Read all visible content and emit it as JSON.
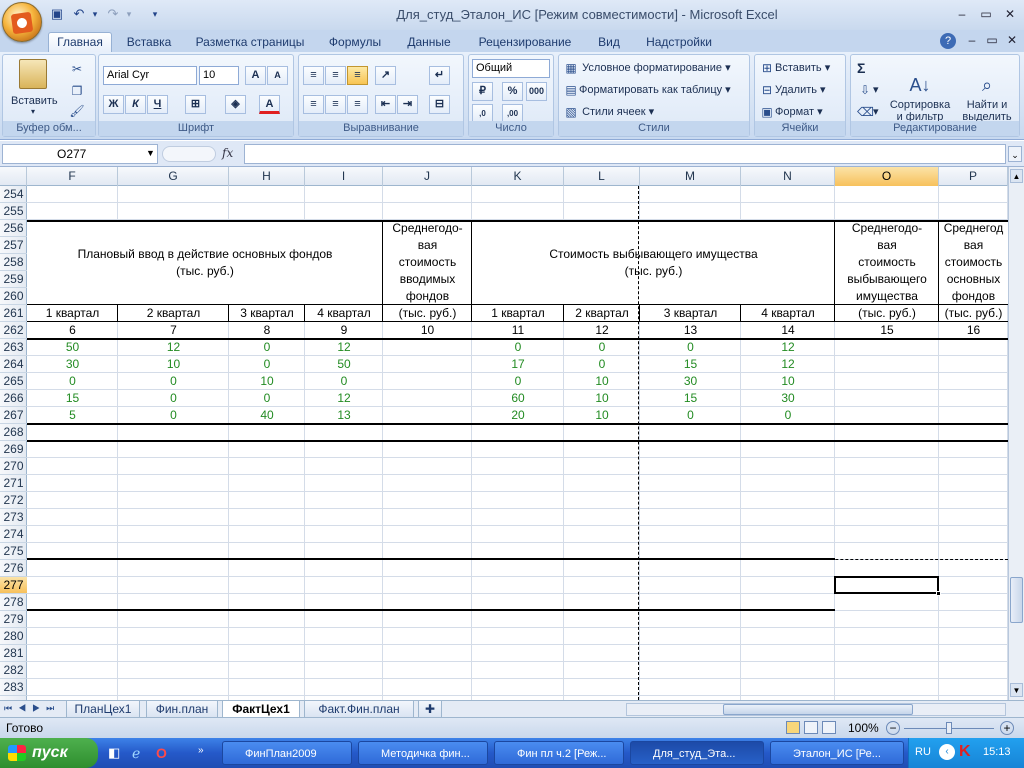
{
  "window": {
    "title": "Для_студ_Эталон_ИС  [Режим совместимости] - Microsoft Excel"
  },
  "tabs": [
    "Главная",
    "Вставка",
    "Разметка страницы",
    "Формулы",
    "Данные",
    "Рецензирование",
    "Вид",
    "Надстройки"
  ],
  "ribbon": {
    "clipboard": {
      "paste": "Вставить",
      "label": "Буфер обм..."
    },
    "font": {
      "name": "Arial Cyr",
      "size": "10",
      "bold": "Ж",
      "italic": "К",
      "underline": "Ч",
      "label": "Шрифт"
    },
    "alignment": {
      "label": "Выравнивание"
    },
    "number": {
      "format": "Общий",
      "percent": "%",
      "thousands": "000",
      "label": "Число"
    },
    "styles": {
      "conditional": "Условное форматирование",
      "table": "Форматировать как таблицу",
      "cell": "Стили ячеек",
      "label": "Стили"
    },
    "cells": {
      "insert": "Вставить",
      "delete": "Удалить",
      "format": "Формат",
      "label": "Ячейки"
    },
    "editing": {
      "sum": "Σ",
      "sort": "Сортировка\nи фильтр",
      "find": "Найти и\nвыделить",
      "label": "Редактирование"
    }
  },
  "formula_bar": {
    "name_box": "O277",
    "fx": "fx",
    "value": ""
  },
  "columns": [
    "F",
    "G",
    "H",
    "I",
    "J",
    "K",
    "L",
    "M",
    "N",
    "O",
    "P"
  ],
  "rows": [
    "254",
    "255",
    "256",
    "257",
    "258",
    "259",
    "260",
    "261",
    "262",
    "263",
    "264",
    "265",
    "266",
    "267",
    "268",
    "269",
    "270",
    "271",
    "272",
    "273",
    "274",
    "275",
    "276",
    "277",
    "278",
    "279",
    "280",
    "281",
    "282",
    "283"
  ],
  "headers": {
    "planned": "Плановый ввод в действие основных фондов",
    "planned_unit": "(тыс. руб.)",
    "avg_input": [
      "Среднегодо-",
      "вая",
      "стоимость",
      "вводимых",
      "фондов",
      "(тыс. руб.)"
    ],
    "retiring": "Стоимость выбывающего имущества",
    "retiring_unit": "(тыс. руб.)",
    "avg_retiring": [
      "Среднегодо-",
      "вая",
      "стоимость",
      "выбывающего",
      "имущества",
      "(тыс. руб.)"
    ],
    "avg_p": [
      "Среднегод",
      "вая",
      "стоимость",
      "основных",
      "фондов",
      "(тыс. руб.)"
    ],
    "quarters": [
      "1 квартал",
      "2 квартал",
      "3 квартал",
      "4 квартал"
    ],
    "col_numbers": [
      "6",
      "7",
      "8",
      "9",
      "10",
      "11",
      "12",
      "13",
      "14",
      "15",
      "16"
    ]
  },
  "data_rows": [
    [
      "50",
      "12",
      "0",
      "12",
      "",
      "0",
      "0",
      "0",
      "12"
    ],
    [
      "30",
      "10",
      "0",
      "50",
      "",
      "17",
      "0",
      "15",
      "12"
    ],
    [
      "0",
      "0",
      "10",
      "0",
      "",
      "0",
      "10",
      "30",
      "10"
    ],
    [
      "15",
      "0",
      "0",
      "12",
      "",
      "60",
      "10",
      "15",
      "30"
    ],
    [
      "5",
      "0",
      "40",
      "13",
      "",
      "20",
      "10",
      "0",
      "0"
    ]
  ],
  "sheets": [
    "ПланЦех1",
    "Фин.план",
    "ФактЦех1",
    "Факт.Фин.план"
  ],
  "status": {
    "ready": "Готово",
    "zoom": "100%"
  },
  "taskbar": {
    "start": "пуск",
    "items": [
      "ФинПлан2009",
      "Методичка фин...",
      "Фин пл ч.2 [Реж...",
      "Для_студ_Эта...",
      "Эталон_ИС [Ре..."
    ],
    "lang": "RU",
    "time": "15:13"
  }
}
